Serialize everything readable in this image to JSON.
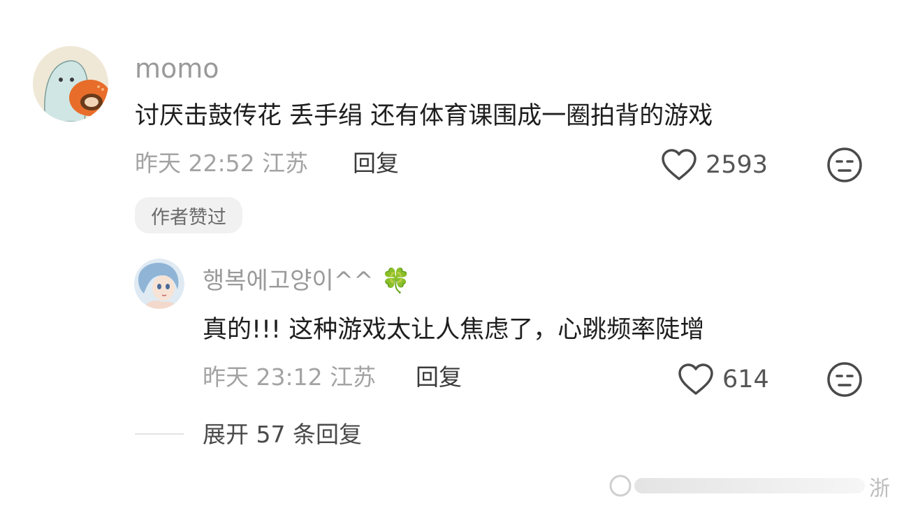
{
  "comment": {
    "username": "momo",
    "text": "讨厌击鼓传花 丢手绢 还有体育课围成一圈拍背的游戏",
    "date": "昨天",
    "time": "22:52",
    "location": "江苏",
    "reply_label": "回复",
    "like_count": "2593",
    "author_badge": "作者赞过"
  },
  "reply": {
    "username": "행복에고양이^^",
    "username_emoji": "🍀",
    "text": "真的!!! 这种游戏太让人焦虑了，心跳频率陡增",
    "date": "昨天",
    "time": "23:12",
    "location": "江苏",
    "reply_label": "回复",
    "like_count": "614"
  },
  "expand_label": "展开 57 条回复",
  "watermark_text": "浙",
  "colors": {
    "background": "#ffffff",
    "muted_text": "#a3a3a3",
    "body_text": "#1e1e1e",
    "badge_bg": "#f1f1f1"
  }
}
